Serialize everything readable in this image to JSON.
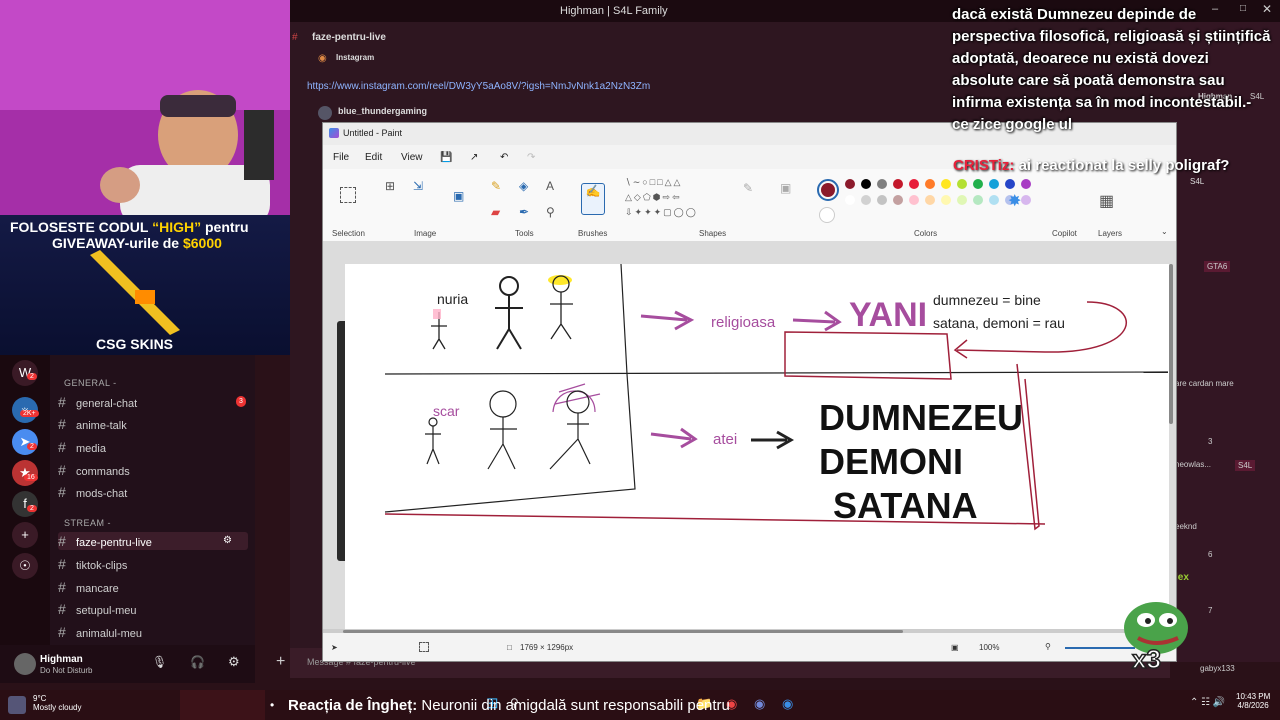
{
  "window_title": "Highman | S4L Family",
  "webcam": {
    "promo_line1_a": "FOLOSESTE CODUL ",
    "promo_code": "“HIGH”",
    "promo_line1_b": " pentru",
    "promo_line2_a": "GIVEAWAY-urile de ",
    "promo_amount": "$6000",
    "brand": "CSG SKINS"
  },
  "discord": {
    "channel_header": "faze-pentru-live",
    "categories": [
      {
        "label": "GENERAL -"
      },
      {
        "label": "STREAM -"
      }
    ],
    "channels": [
      {
        "name": "general-chat",
        "badge": "3"
      },
      {
        "name": "anime-talk"
      },
      {
        "name": "media"
      },
      {
        "name": "commands"
      },
      {
        "name": "mods-chat"
      },
      {
        "name": "faze-pentru-live"
      },
      {
        "name": "tiktok-clips"
      },
      {
        "name": "mancare"
      },
      {
        "name": "setupul-meu"
      },
      {
        "name": "animalul-meu"
      }
    ],
    "server_badges": [
      "2",
      "2K+",
      "2",
      "16",
      "2"
    ],
    "user": {
      "name": "Highman",
      "status": "Do Not Disturb"
    },
    "message_placeholder": "Message # faze-pentru-live",
    "messages": [
      {
        "author": "Instagram"
      },
      {
        "link": "https://www.instagram.com/reel/DW3yY5aAo8V/?igsh=NmJvNnk1a2NzN3Zm"
      },
      {
        "author": "blue_thundergaming"
      }
    ],
    "right_labels": [
      "Highman",
      "S4L",
      "S4L",
      "GTA6",
      "are cardan mare",
      "3",
      "neowlas...",
      "S4L",
      "eeknd",
      "6",
      "lex",
      "7",
      "gabyx133"
    ]
  },
  "paint": {
    "title": "Untitled - Paint",
    "menu": [
      "File",
      "Edit",
      "View"
    ],
    "ribbon_groups": [
      "Selection",
      "Image",
      "Tools",
      "Brushes",
      "Shapes",
      "Colors",
      "Copilot",
      "Layers"
    ],
    "colors": [
      "#8b1a2b",
      "#000000",
      "#7f7f7f",
      "#c3182b",
      "#e81c3a",
      "#ff7b29",
      "#ffe621",
      "#b4e033",
      "#22b04c",
      "#15a1d9",
      "#2545c8",
      "#a83cc4",
      "#ffffff",
      "#d1d1d1",
      "#c3c3c3",
      "#c3a0a0",
      "#ffc1cf",
      "#ffd7a6",
      "#fff8b0",
      "#e0f7b5",
      "#b5e8c1",
      "#b0e0f2",
      "#b5c2ee",
      "#d7b7ee"
    ],
    "primary_color": "#8b1a2b",
    "secondary_color": "#ffffff",
    "canvas_size": "1769 × 1296px",
    "zoom": "100%",
    "drawing_text": {
      "nuria": "nuria",
      "scar": "scar",
      "religioasa": "religioasa",
      "yani": "YANI",
      "dumnezeu_bine": "dumnezeu = bine",
      "satana_rau": "satana, demoni = rau",
      "atei": "atei",
      "caps1": "DUMNEZEU",
      "caps2": "DEMONI",
      "caps3": "SATANA"
    }
  },
  "subtitle": "dacă există Dumnezeu depinde de perspectiva filosofică, religioasă și științifică adoptată, deoarece nu există dovezi absolute care să poată demonstra sau infirma existența sa în mod incontestabil.- ce zice google ul",
  "chat_overlay": {
    "user": "CRISTiz:",
    "text": " ai reactionat la selly poligraf?"
  },
  "emote_text": "x3",
  "ticker": {
    "bold": "Reacția de Îngheț:",
    "text": " Neuronii din amigdală sunt responsabili pentru"
  },
  "taskbar": {
    "temp": "9°C",
    "weather": "Mostly cloudy",
    "time": "10:43 PM",
    "date": "4/8/2026"
  }
}
